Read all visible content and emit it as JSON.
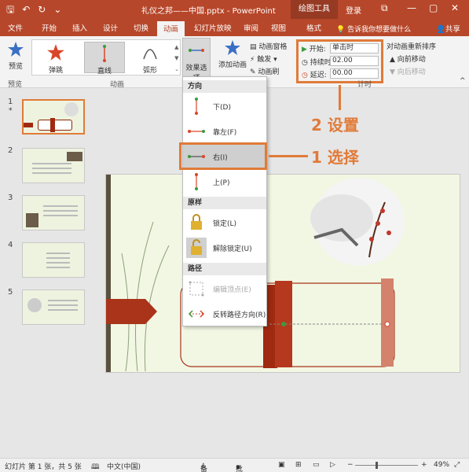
{
  "titlebar": {
    "title": "礼仪之邦——中国.pptx  -  PowerPoint",
    "contextual": "绘图工具",
    "login": "登录",
    "icons": [
      "save-icon",
      "undo-icon",
      "redo-icon",
      "customize-icon"
    ]
  },
  "tabs": [
    "文件",
    "开始",
    "插入",
    "设计",
    "切换",
    "动画",
    "幻灯片放映",
    "审阅",
    "视图",
    "格式"
  ],
  "active_tab": "动画",
  "tell_me": "告诉我你想要做什么",
  "share": "共享",
  "ribbon": {
    "preview_label": "预览",
    "preview_group": "预览",
    "gallery_items": [
      "弹跳",
      "直线",
      "弧形"
    ],
    "animation_group": "动画",
    "effect_options": "效果选项",
    "add_animation": "添加动画",
    "animation_pane": "动画窗格",
    "trigger": "触发",
    "animation_painter": "动画刷",
    "start_label": "开始:",
    "start_value": "单击时",
    "duration_label": "持续时间:",
    "duration_value": "02.00",
    "delay_label": "延迟:",
    "delay_value": "00.00",
    "timing_group": "计时",
    "reorder_title": "对动画重新排序",
    "move_earlier": "向前移动",
    "move_later": "向后移动"
  },
  "dropdown": {
    "direction_header": "方向",
    "items": [
      {
        "label": "下(D)"
      },
      {
        "label": "靠左(F)"
      },
      {
        "label": "右(I)"
      },
      {
        "label": "上(P)"
      }
    ],
    "lock_header": "原样",
    "lock": "锁定(L)",
    "unlock": "解除锁定(U)",
    "path_header": "路径",
    "edit_points": "编辑顶点(E)",
    "reverse_path": "反转路径方向(R)"
  },
  "annotations": {
    "step1": "1 选择",
    "step2": "2 设置"
  },
  "slides": [
    1,
    2,
    3,
    4,
    5
  ],
  "selected_slide": 1,
  "statusbar": {
    "slide_info": "幻灯片 第 1 张，共 5 张",
    "language": "中文(中国)",
    "notes": "备注",
    "comments": "批注",
    "zoom": "49%"
  },
  "colors": {
    "accent": "#b7472a",
    "annotation": "#e07b39"
  }
}
